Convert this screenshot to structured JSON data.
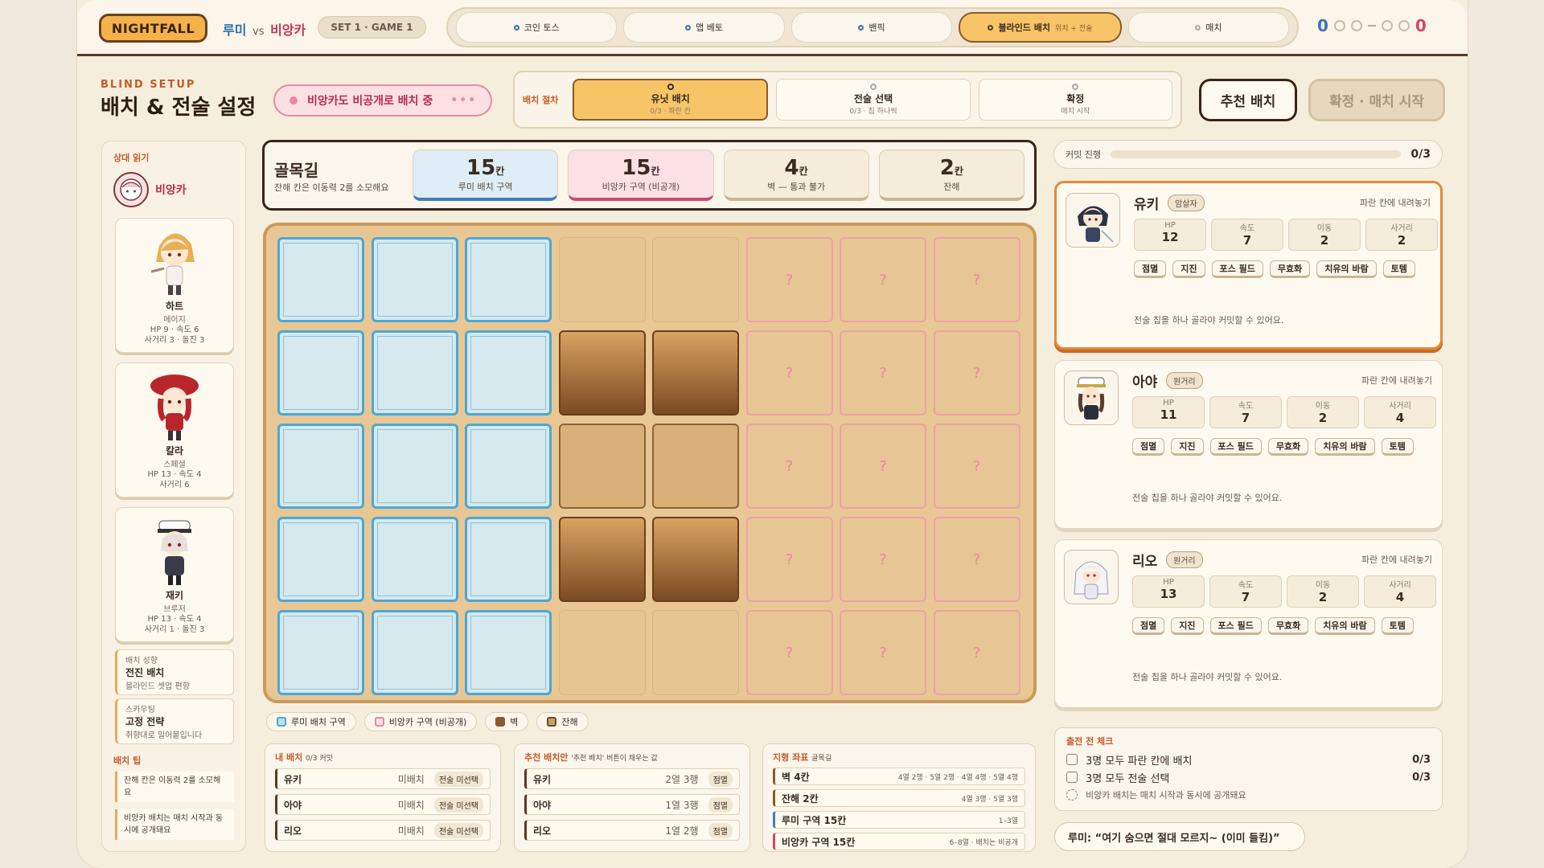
{
  "top": {
    "logo": "NIGHTFALL",
    "player_a": "루미",
    "vs": "vs",
    "player_b": "비앙카",
    "set": "SET 1 · GAME 1",
    "phases": [
      {
        "label": "코인 토스",
        "sub": ""
      },
      {
        "label": "맵 베토",
        "sub": ""
      },
      {
        "label": "밴픽",
        "sub": ""
      },
      {
        "label": "블라인드 배치",
        "sub": "위치 + 전술"
      },
      {
        "label": "매치",
        "sub": ""
      }
    ],
    "score_a": "0",
    "score_b": "0"
  },
  "header": {
    "title_en": "BLIND SETUP",
    "title_ko": "배치 & 전술 설정",
    "enemy_status": "비앙카도 비공개로 배치 중",
    "steps_label": "배치 절차",
    "steps": [
      {
        "title": "유닛 배치",
        "sub": "0/3 · 파란 칸"
      },
      {
        "title": "전술 선택",
        "sub": "0/3 · 칩 하나씩"
      },
      {
        "title": "확정",
        "sub": "매치 시작"
      }
    ],
    "recommend_button": "추천 배치",
    "confirm_button": "확정 · 매치 시작"
  },
  "left": {
    "heading": "상대 읽기",
    "opponent": "비앙카",
    "enemies": [
      {
        "name": "하트",
        "role": "메이지",
        "stats1": "HP 9 · 속도 6",
        "stats2": "사거리 3 · 돌진 3"
      },
      {
        "name": "칼라",
        "role": "스페셜",
        "stats1": "HP 13 · 속도 4",
        "stats2": "사거리 6"
      },
      {
        "name": "재키",
        "role": "브루저",
        "stats1": "HP 13 · 속도 4",
        "stats2": "사거리 1 · 돌진 3"
      }
    ],
    "notes": [
      {
        "a": "배치 성향",
        "b": "전진 배치",
        "c": "블라인드 셋업 편향"
      },
      {
        "a": "스카우팅",
        "b": "고정 전략",
        "c": "취향대로 밀어붙입니다"
      }
    ],
    "tips_heading": "배치 팁",
    "tips": [
      "잔해 칸은 이동력 2를 소모해요",
      "비앙카 배치는 매치 시작과 동시에 공개돼요"
    ]
  },
  "map": {
    "name": "골목길",
    "desc": "잔해 칸은 이동력 2를 소모해요",
    "stats": [
      {
        "value": "15",
        "unit": "칸",
        "label": "루미 배치 구역"
      },
      {
        "value": "15",
        "unit": "칸",
        "label": "비앙카 구역 (비공개)"
      },
      {
        "value": "4",
        "unit": "칸",
        "label": "벽 — 통과 불가"
      },
      {
        "value": "2",
        "unit": "칸",
        "label": "잔해"
      }
    ],
    "hidden_mark": "?"
  },
  "legend": [
    "루미 배치 구역",
    "비앙카 구역 (비공개)",
    "벽",
    "잔해"
  ],
  "my_setup": {
    "heading": "내 배치",
    "count": "0/3 커밋",
    "rows": [
      {
        "name": "유키",
        "pos": "미배치",
        "tag": "전술 미선택"
      },
      {
        "name": "아야",
        "pos": "미배치",
        "tag": "전술 미선택"
      },
      {
        "name": "리오",
        "pos": "미배치",
        "tag": "전술 미선택"
      }
    ]
  },
  "recommended": {
    "heading": "추천 배치안",
    "note": "'추천 배치' 버튼이 채우는 값",
    "rows": [
      {
        "name": "유키",
        "pos": "2열 3행",
        "tag": "점멸"
      },
      {
        "name": "아야",
        "pos": "1열 3행",
        "tag": "점멸"
      },
      {
        "name": "리오",
        "pos": "1열 2행",
        "tag": "점멸"
      }
    ]
  },
  "terrain": {
    "heading": "지형 좌표",
    "map": "골목길",
    "rows": [
      {
        "name": "벽 4칸",
        "value": "4열 2행 · 5열 2행 · 4열 4행 · 5열 4행"
      },
      {
        "name": "잔해 2칸",
        "value": "4열 3행 · 5열 3행"
      },
      {
        "name": "루미 구역 15칸",
        "value": "1–3열"
      },
      {
        "name": "비앙카 구역 15칸",
        "value": "6–8열 · 배치는 비공개"
      }
    ]
  },
  "progress": {
    "label": "커밋 진행",
    "count": "0/3",
    "fraction": 0
  },
  "units": [
    {
      "name": "유키",
      "role": "암살자",
      "hint": "파란 칸에 내려놓기",
      "hp": "12",
      "speed": "7",
      "move": "2",
      "range": "2"
    },
    {
      "name": "아야",
      "role": "원거리",
      "hint": "파란 칸에 내려놓기",
      "hp": "11",
      "speed": "7",
      "move": "2",
      "range": "4"
    },
    {
      "name": "리오",
      "role": "원거리",
      "hint": "파란 칸에 내려놓기",
      "hp": "13",
      "speed": "7",
      "move": "2",
      "range": "4"
    }
  ],
  "stat_labels": {
    "hp": "HP",
    "speed": "속도",
    "move": "이동",
    "range": "사거리"
  },
  "skills": [
    "점멸",
    "지진",
    "포스 필드",
    "무효화",
    "치유의 바람",
    "토템"
  ],
  "skill_note": "전술 칩을 하나 골라야 커밋할 수 있어요.",
  "checklist": {
    "heading": "출전 전 체크",
    "rows": [
      {
        "text": "3명 모두 파란 칸에 배치",
        "count": "0/3"
      },
      {
        "text": "3명 모두 전술 선택",
        "count": "0/3"
      },
      {
        "text": "비앙카 배치는 매치 시작과 동시에 공개돼요",
        "count": ""
      }
    ]
  },
  "quote": "루미: “여기 숨으면 절대 모르지~ (이미 들킴)”",
  "colors": {
    "blue_zone": "#d5e9ee",
    "pink_zone": "#e8c594",
    "wall": "#8a5a2e",
    "ruin": "#d9b078",
    "accent": "#f7c567"
  }
}
